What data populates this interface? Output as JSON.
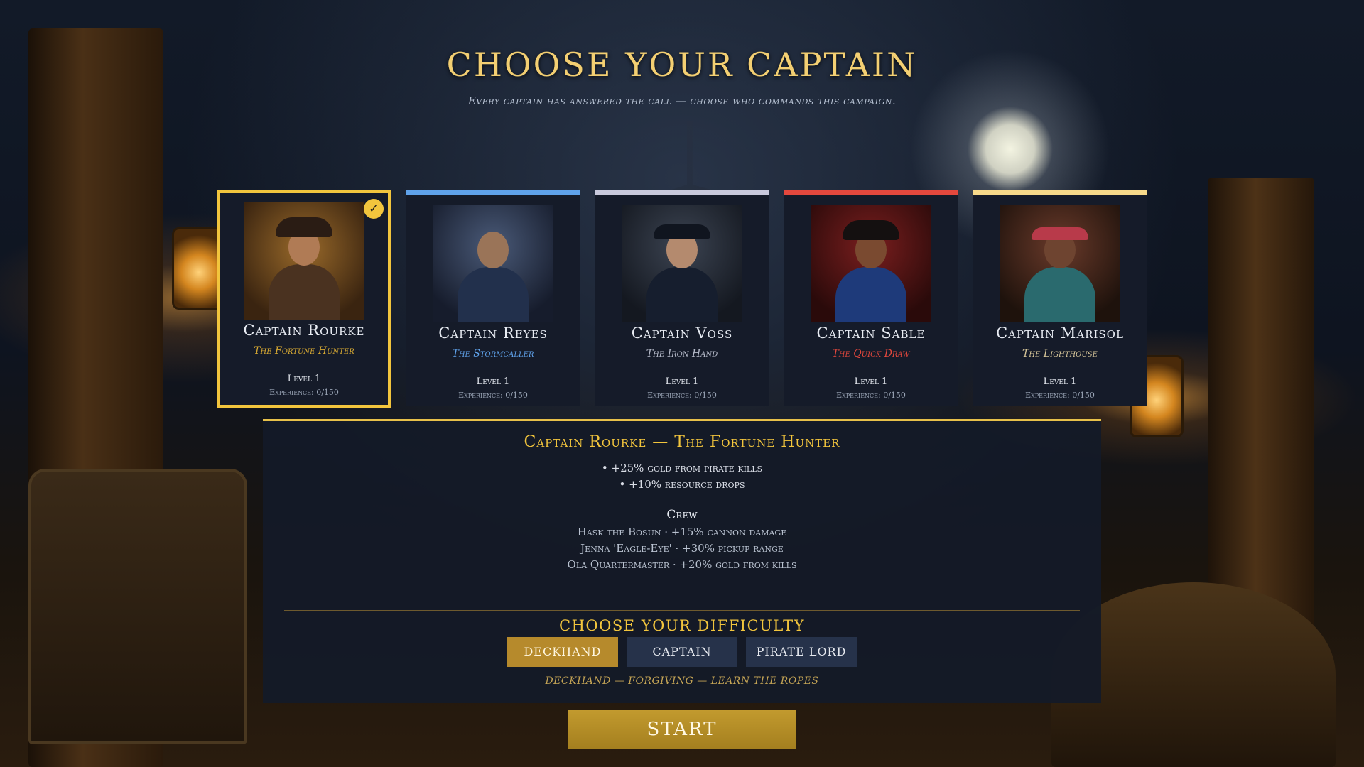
{
  "header": {
    "title": "Choose Your Captain",
    "subtitle": "Every captain has answered the call — choose who commands this campaign."
  },
  "captains": [
    {
      "name": "Captain Rourke",
      "epithet": "The Fortune Hunter",
      "level": "Level 1",
      "experience": "Experience: 0/150",
      "accent": "#f2c53d",
      "selected": true
    },
    {
      "name": "Captain Reyes",
      "epithet": "The Stormcaller",
      "level": "Level 1",
      "experience": "Experience: 0/150",
      "accent": "#5fa2ea",
      "selected": false
    },
    {
      "name": "Captain Voss",
      "epithet": "The Iron Hand",
      "level": "Level 1",
      "experience": "Experience: 0/150",
      "accent": "#c9c9dc",
      "selected": false
    },
    {
      "name": "Captain Sable",
      "epithet": "The Quick Draw",
      "level": "Level 1",
      "experience": "Experience: 0/150",
      "accent": "#e4483d",
      "selected": false
    },
    {
      "name": "Captain Marisol",
      "epithet": "The Lighthouse",
      "level": "Level 1",
      "experience": "Experience: 0/150",
      "accent": "#f7d98a",
      "selected": false
    }
  ],
  "detail": {
    "title": "Captain Rourke — The Fortune Hunter",
    "perks": [
      "• +25% gold from pirate kills",
      "• +10% resource drops"
    ],
    "crew_title": "Crew",
    "crew": [
      "Hask the Bosun · +15% cannon damage",
      "Jenna 'Eagle-Eye' · +30% pickup range",
      "Ola Quartermaster · +20% gold from kills"
    ]
  },
  "difficulty": {
    "title": "Choose Your Difficulty",
    "options": [
      "Deckhand",
      "Captain",
      "Pirate Lord"
    ],
    "selected": "Deckhand",
    "description": "Deckhand — Forgiving — Learn the ropes"
  },
  "start_label": "Start",
  "colors": {
    "gold": "#f2c53d",
    "panel": "#141a28",
    "button": "#26324a",
    "button_active": "#b68a2c"
  }
}
